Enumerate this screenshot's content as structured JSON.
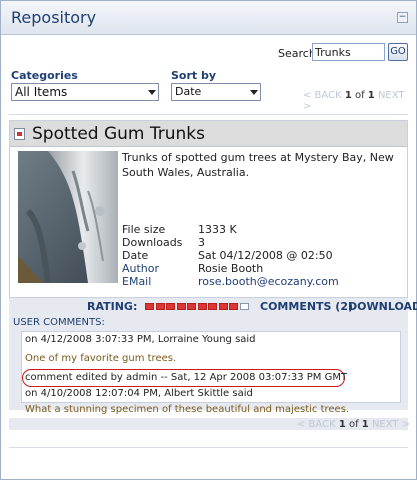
{
  "panel": {
    "title": "Repository",
    "collapse_symbol": "⊟"
  },
  "search": {
    "label": "Search",
    "value": "Trunks",
    "button": "GO"
  },
  "filters": {
    "categories_label": "Categories",
    "categories_value": "All Items",
    "sortby_label": "Sort by",
    "sortby_value": "Date"
  },
  "pager_top": {
    "back": "< BACK",
    "current": "1",
    "of_text": "of",
    "total": "1",
    "next": "NEXT >"
  },
  "pager_bottom": {
    "back": "< BACK",
    "current": "1",
    "of_text": "of",
    "total": "1",
    "next": "NEXT >"
  },
  "item": {
    "title": "Spotted Gum Trunks",
    "description": "Trunks of spotted gum trees at Mystery Bay, New South Wales, Australia.",
    "meta": [
      {
        "key": "File size",
        "value": "1333 K"
      },
      {
        "key": "Downloads",
        "value": "3"
      },
      {
        "key": "Date",
        "value": "Sat 04/12/2008 @ 02:50"
      },
      {
        "key": "Author",
        "value": "Rosie Booth"
      },
      {
        "key": "EMail",
        "value": "rose.booth@ecozany.com"
      }
    ]
  },
  "rating": {
    "label": "RATING:",
    "value": 9,
    "max": 10,
    "comments_link": "COMMENTS (2)",
    "download_link": "DOWNLOAD"
  },
  "comments": {
    "header": "USER COMMENTS:",
    "lines": [
      "on 4/12/2008 3:07:33 PM, Lorraine Young said",
      "One of my favorite gum trees.",
      "comment edited by admin -- Sat, 12 Apr 2008 03:07:33 PM GMT",
      "on 4/10/2008 12:07:04 PM, Albert Skittle said",
      "What a stunning specimen of these beautiful and majestic trees."
    ]
  },
  "colors": {
    "accent": "#1f3f73",
    "rating_fill": "#e03535",
    "highlight_oval": "#d01a1a"
  },
  "icons": {
    "collapse": "collapse-icon",
    "item_file": "file-icon"
  }
}
